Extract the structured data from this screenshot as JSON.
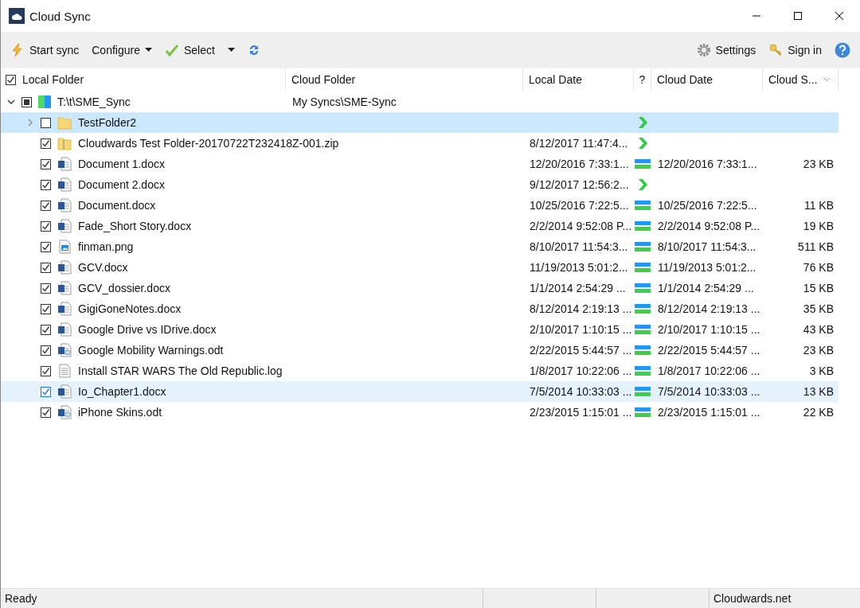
{
  "window": {
    "title": "Cloud Sync"
  },
  "toolbar": {
    "left": [
      {
        "kind": "sync",
        "label": "Start sync"
      },
      {
        "kind": "menu",
        "label": "Configure"
      },
      {
        "kind": "select",
        "label": "Select"
      },
      {
        "kind": "dropdown"
      },
      {
        "kind": "refresh"
      }
    ],
    "right": [
      {
        "kind": "settings",
        "label": "Settings"
      },
      {
        "kind": "signin",
        "label": "Sign in"
      },
      {
        "kind": "help"
      }
    ]
  },
  "table": {
    "header_checked": true,
    "columns": [
      "Local Folder",
      "Cloud Folder",
      "Local Date",
      "?",
      "Cloud Date",
      "Cloud S..."
    ],
    "root": {
      "name": "T:\\t\\SME_Sync",
      "cloud_folder": "My Syncs\\SME-Sync",
      "expanded": true,
      "partial": true
    },
    "rows": [
      {
        "kind": "folder",
        "name": "TestFolder2",
        "expanded": false,
        "checked": false,
        "selected": true,
        "hovered": false,
        "in_sync": false
      },
      {
        "kind": "zip",
        "name": "Cloudwards Test Folder-20170722T232418Z-001.zip",
        "checked": true,
        "selected": false,
        "hovered": false,
        "local_date": "8/12/2017 11:47:4...",
        "in_sync": false
      },
      {
        "kind": "word",
        "name": "Document 1.docx",
        "checked": true,
        "selected": false,
        "hovered": false,
        "local_date": "12/20/2016 7:33:1...",
        "in_sync": true,
        "cloud_date": "12/20/2016 7:33:1...",
        "size": "23 KB"
      },
      {
        "kind": "word",
        "name": "Document 2.docx",
        "checked": true,
        "selected": false,
        "hovered": false,
        "local_date": "9/12/2017 12:56:2...",
        "in_sync": false
      },
      {
        "kind": "word",
        "name": "Document.docx",
        "checked": true,
        "selected": false,
        "hovered": false,
        "local_date": "10/25/2016 7:22:5...",
        "in_sync": true,
        "cloud_date": "10/25/2016 7:22:5...",
        "size": "11 KB"
      },
      {
        "kind": "word",
        "name": "Fade_Short Story.docx",
        "checked": true,
        "selected": false,
        "hovered": false,
        "local_date": "2/2/2014 9:52:08 P...",
        "in_sync": true,
        "cloud_date": "2/2/2014 9:52:08 P...",
        "size": "19 KB"
      },
      {
        "kind": "image",
        "name": "finman.png",
        "checked": true,
        "selected": false,
        "hovered": false,
        "local_date": "8/10/2017 11:54:3...",
        "in_sync": true,
        "cloud_date": "8/10/2017 11:54:3...",
        "size": "511 KB"
      },
      {
        "kind": "word",
        "name": "GCV.docx",
        "checked": true,
        "selected": false,
        "hovered": false,
        "local_date": "11/19/2013 5:01:2...",
        "in_sync": true,
        "cloud_date": "11/19/2013 5:01:2...",
        "size": "76 KB"
      },
      {
        "kind": "word",
        "name": "GCV_dossier.docx",
        "checked": true,
        "selected": false,
        "hovered": false,
        "local_date": "1/1/2014 2:54:29 ...",
        "in_sync": true,
        "cloud_date": "1/1/2014 2:54:29 ...",
        "size": "15 KB"
      },
      {
        "kind": "word",
        "name": "GigiGoneNotes.docx",
        "checked": true,
        "selected": false,
        "hovered": false,
        "local_date": "8/12/2014 2:19:13 ...",
        "in_sync": true,
        "cloud_date": "8/12/2014 2:19:13 ...",
        "size": "35 KB"
      },
      {
        "kind": "word",
        "name": "Google Drive vs IDrive.docx",
        "checked": true,
        "selected": false,
        "hovered": false,
        "local_date": "2/10/2017 1:10:15 ...",
        "in_sync": true,
        "cloud_date": "2/10/2017 1:10:15 ...",
        "size": "43 KB"
      },
      {
        "kind": "odt",
        "name": "Google Mobility Warnings.odt",
        "checked": true,
        "selected": false,
        "hovered": false,
        "local_date": "2/22/2015 5:44:57 ...",
        "in_sync": true,
        "cloud_date": "2/22/2015 5:44:57 ...",
        "size": "23 KB"
      },
      {
        "kind": "text",
        "name": "Install STAR WARS The Old Republic.log",
        "checked": true,
        "selected": false,
        "hovered": false,
        "local_date": "1/8/2017 10:22:06 ...",
        "in_sync": true,
        "cloud_date": "1/8/2017 10:22:06 ...",
        "size": "3 KB"
      },
      {
        "kind": "word",
        "name": "Io_Chapter1.docx",
        "checked": true,
        "selected": false,
        "hovered": true,
        "local_date": "7/5/2014 10:33:03 ...",
        "in_sync": true,
        "cloud_date": "7/5/2014 10:33:03 ...",
        "size": "13 KB"
      },
      {
        "kind": "odt",
        "name": "iPhone Skins.odt",
        "checked": true,
        "selected": false,
        "hovered": false,
        "local_date": "2/23/2015 1:15:01 ...",
        "in_sync": true,
        "cloud_date": "2/23/2015 1:15:01 ...",
        "size": "22 KB"
      }
    ]
  },
  "status_bar": {
    "status": "Ready",
    "site": "Cloudwards.net"
  }
}
